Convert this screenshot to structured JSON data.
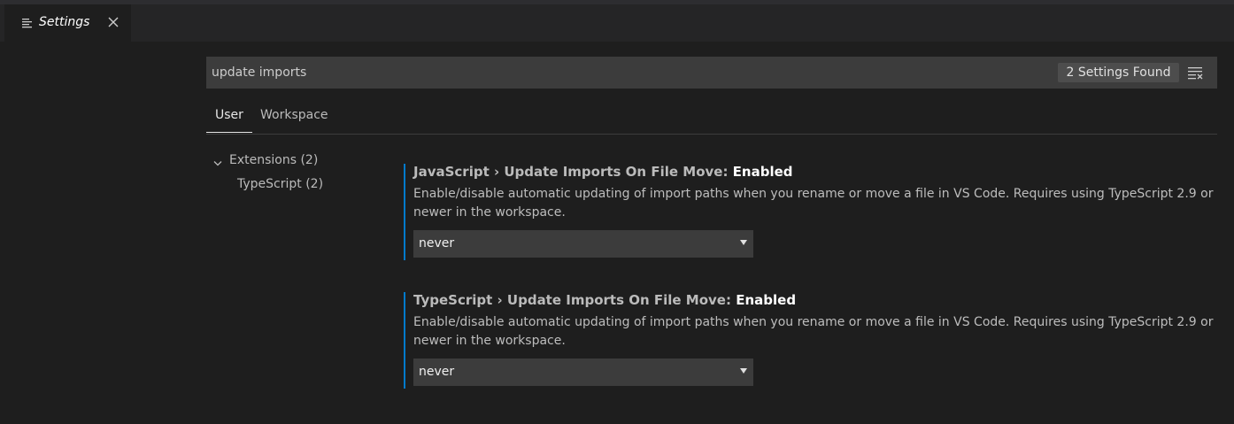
{
  "editor": {
    "tab_title": "Settings",
    "tab_icon": "settings-lines-icon",
    "close_icon": "close-icon"
  },
  "search": {
    "value": "update imports",
    "results_count": "2 Settings Found",
    "clear_icon": "clear-filter-icon"
  },
  "scope_tabs": [
    {
      "label": "User",
      "active": true
    },
    {
      "label": "Workspace",
      "active": false
    }
  ],
  "toc": {
    "group_label": "Extensions (2)",
    "child_label": "TypeScript (2)"
  },
  "settings": [
    {
      "category": "JavaScript › Update Imports On File Move: ",
      "name": "Enabled",
      "description": "Enable/disable automatic updating of import paths when you rename or move a file in VS Code. Requires using TypeScript 2.9 or newer in the workspace.",
      "value": "never"
    },
    {
      "category": "TypeScript › Update Imports On File Move: ",
      "name": "Enabled",
      "description": "Enable/disable automatic updating of import paths when you rename or move a file in VS Code. Requires using TypeScript 2.9 or newer in the workspace.",
      "value": "never"
    }
  ],
  "colors": {
    "background": "#1e1e1e",
    "accent_border": "#007acc",
    "input_bg": "#3c3c3c"
  }
}
